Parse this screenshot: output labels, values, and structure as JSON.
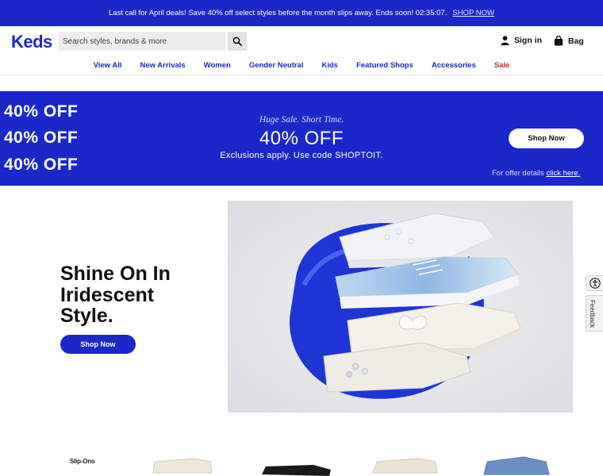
{
  "promo": {
    "message": "Last call for April deals! Save 40% off select styles before the month slips away. Ends soon! 02:35:07.",
    "link": "SHOP NOW"
  },
  "header": {
    "logo": "Keds",
    "search_placeholder": "Search styles, brands & more",
    "sign_in": "Sign in",
    "bag": "Bag"
  },
  "nav": {
    "items": [
      "View All",
      "New Arrivals",
      "Women",
      "Gender Neutral",
      "Kids",
      "Featured Shops",
      "Accessories",
      "Sale"
    ]
  },
  "banner": {
    "stack_line": "40% OFF",
    "tagline": "Huge Sale. Short Time.",
    "headline": "40% OFF",
    "code_text": "Exclusions apply. Use code SHOPTOIT.",
    "button": "Shop Now",
    "details_text": "For offer details",
    "details_link": "click here."
  },
  "hero": {
    "title": "Shine On In Iridescent Style.",
    "button": "Shop Now"
  },
  "side": {
    "feedback": "Feedback"
  },
  "section": {
    "label": "Slip-Ons"
  },
  "colors": {
    "brand_blue": "#1b28c9",
    "sale_red": "#d71b27"
  }
}
